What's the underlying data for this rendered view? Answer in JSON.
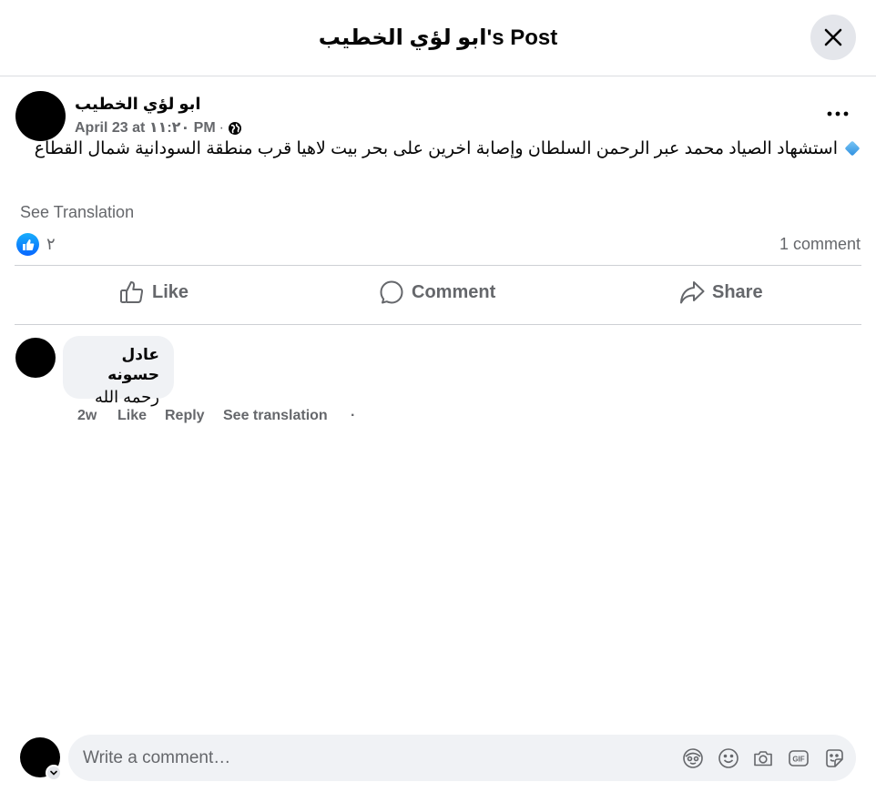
{
  "header": {
    "title": "ابو لؤي الخطيب's Post"
  },
  "post": {
    "author": "ابو لؤي الخطيب",
    "date": "April 23 at ١١:٢٠ PM",
    "separator": "·",
    "privacy_icon": "globe-icon",
    "text": "استشهاد الصياد محمد عبر الرحمن السلطان وإصابة اخرين على بحر بيت لاهيا قرب منطقة السودانية شمال القطاع",
    "see_translation": "See Translation",
    "reaction_count": "٢",
    "comment_count": "1 comment"
  },
  "actions": {
    "like": "Like",
    "comment": "Comment",
    "share": "Share"
  },
  "comment": {
    "author": "عادل حسونه",
    "text": "رحمه الله",
    "time": "2w",
    "like": "Like",
    "reply": "Reply",
    "see_translation": "See translation",
    "dot": "·"
  },
  "composer": {
    "placeholder": "Write a comment…",
    "icons": [
      "avatar-sticker-icon",
      "emoji-icon",
      "camera-icon",
      "gif-icon",
      "sticker-icon"
    ]
  },
  "colors": {
    "accent": "#0866ff",
    "secondary_text": "#65676b",
    "bubble": "#f0f2f5"
  }
}
